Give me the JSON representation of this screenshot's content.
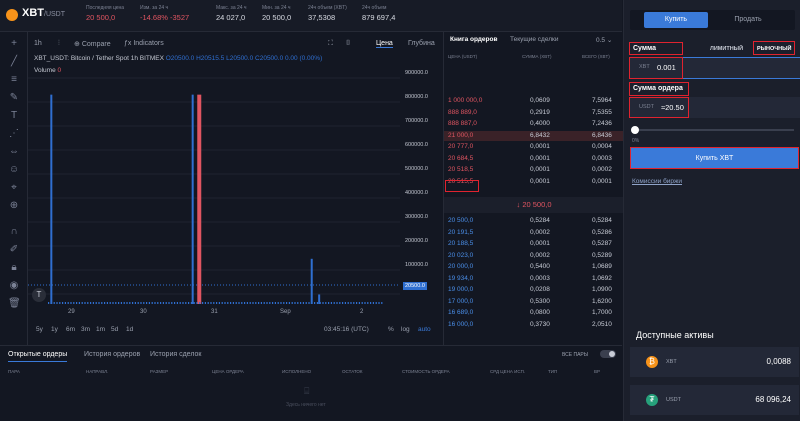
{
  "header": {
    "pair": "XBT",
    "pair_quote": "/USDT",
    "stats": [
      {
        "label": "Последняя цена",
        "value": "20 500,0",
        "tone": "red"
      },
      {
        "label": "Изм. за 24 ч",
        "value": "-14.68%  -3527",
        "tone": "red"
      },
      {
        "label": "Макс. за 24 ч",
        "value": "24 027,0",
        "tone": ""
      },
      {
        "label": "Мин. за 24 ч",
        "value": "20 500,0",
        "tone": ""
      },
      {
        "label": "24ч объем (XBT)",
        "value": "37,5308",
        "tone": ""
      },
      {
        "label": "24ч объем",
        "value": "879 697,4",
        "tone": ""
      }
    ]
  },
  "chart_toolbar": {
    "interval": "1h",
    "compare": "Compare",
    "indicators": "Indicators",
    "tab_price": "Цена",
    "tab_depth": "Глубина"
  },
  "chart": {
    "legend_symbol": "XBT_USDT: Bitcoin / Tether Spot  1h  BITMEX",
    "legend_ohlc": "O20500.0  H20515.5  L20500.0  C20500.0  0.00 (0.00%)",
    "volume_label": "Volume",
    "volume_value": "0",
    "current_price": "20500.0",
    "time": "03:45:16 (UTC)",
    "pct": "%",
    "log": "log",
    "auto": "auto",
    "ranges": [
      "5y",
      "1y",
      "6m",
      "3m",
      "1m",
      "5d",
      "1d"
    ]
  },
  "chart_data": {
    "type": "bar",
    "x_ticks": [
      "29",
      "30",
      "31",
      "Sep",
      "2"
    ],
    "y_ticks": [
      "900000.0",
      "800000.0",
      "700000.0",
      "600000.0",
      "500000.0",
      "400000.0",
      "300000.0",
      "200000.0",
      "100000.0"
    ],
    "ylim": [
      0,
      950000
    ],
    "series": [
      {
        "name": "",
        "color": "#2f6fd1",
        "points": [
          {
            "x": 0.06,
            "y": 880000
          },
          {
            "x": 0.44,
            "y": 880000
          },
          {
            "x": 0.76,
            "y": 190000
          },
          {
            "x": 0.78,
            "y": 40000
          }
        ]
      },
      {
        "name": "",
        "color": "#e05561",
        "points": [
          {
            "x": 0.455,
            "y": 880000
          }
        ]
      }
    ]
  },
  "orderbook": {
    "tab_book": "Книга ордеров",
    "tab_trades": "Текущие сделки",
    "step": "0.5",
    "headers": [
      "ЦЕНА (USDT)",
      "СУММА (XBT)",
      "ВСЕГО (XBT)"
    ],
    "asks": [
      [
        "1 000 000,0",
        "0,0609",
        "7,5964"
      ],
      [
        "888 889,0",
        "0,2919",
        "7,5355"
      ],
      [
        "888 887,0",
        "0,4000",
        "7,2436"
      ],
      [
        "21 000,0",
        "6,8432",
        "6,8436"
      ],
      [
        "20 777,0",
        "0,0001",
        "0,0004"
      ],
      [
        "20 684,5",
        "0,0001",
        "0,0003"
      ],
      [
        "20 518,5",
        "0,0001",
        "0,0002"
      ],
      [
        "20 515,5",
        "0,0001",
        "0,0001"
      ]
    ],
    "last_price": "↓ 20 500,0",
    "bids": [
      [
        "20 500,0",
        "0,5284",
        "0,5284"
      ],
      [
        "20 191,5",
        "0,0002",
        "0,5286"
      ],
      [
        "20 188,5",
        "0,0001",
        "0,5287"
      ],
      [
        "20 023,0",
        "0,0002",
        "0,5289"
      ],
      [
        "20 000,0",
        "0,5400",
        "1,0689"
      ],
      [
        "19 934,0",
        "0,0003",
        "1,0692"
      ],
      [
        "19 000,0",
        "0,0208",
        "1,0900"
      ],
      [
        "17 000,0",
        "0,5300",
        "1,6200"
      ],
      [
        "16 689,0",
        "0,0800",
        "1,7000"
      ],
      [
        "16 000,0",
        "0,3730",
        "2,0510"
      ]
    ]
  },
  "trade": {
    "buy_tab": "Купить",
    "sell_tab": "Продать",
    "amount_label": "Сумма",
    "limit": "ЛИМИТНЫЙ",
    "market": "РЫНОЧНЫЙ",
    "amount_unit": "XBT",
    "amount_value": "0.001",
    "order_sum_label": "Сумма ордера",
    "order_unit": "USDT",
    "order_value": "≈20.50",
    "slider_pct": "0%",
    "buy_button": "Купить XBT",
    "fees_link": "Комиссии биржи",
    "assets_title": "Доступные активы",
    "assets": [
      {
        "name": "XBT",
        "amount": "0,0088",
        "color": "#f7931a",
        "symbol": "₿"
      },
      {
        "name": "USDT",
        "amount": "68 096,24",
        "color": "#26a17b",
        "symbol": "₮"
      }
    ]
  },
  "bottom": {
    "tabs": [
      "Открытые ордеры",
      "История ордеров",
      "История сделок"
    ],
    "all_pairs": "ВСЕ ПАРЫ",
    "columns": [
      "ПАРА",
      "НАПРАВЛ.",
      "РАЗМЕР",
      "ЦЕНА ОРДЕРА",
      "ИСПОЛНЕНО",
      "ОСТАТОК",
      "СТОИМОСТЬ ОРДЕРА",
      "СРД ЦЕНА ИСП.",
      "ТИП",
      "ВР"
    ],
    "empty_text": "Здесь ничего нет"
  }
}
